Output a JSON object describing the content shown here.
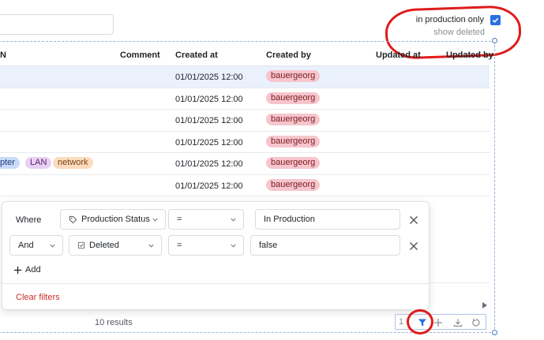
{
  "toggles": {
    "production_label": "in production only",
    "deleted_label": "show deleted"
  },
  "columns": [
    "N",
    "Comment",
    "Created at",
    "Created by",
    "Updated at",
    "Updated by"
  ],
  "rows": [
    {
      "created_at": "01/01/2025 12:00",
      "created_by": "bauergeorg",
      "selected": true
    },
    {
      "created_at": "01/01/2025 12:00",
      "created_by": "bauergeorg"
    },
    {
      "created_at": "01/01/2025 12:00",
      "created_by": "bauergeorg"
    },
    {
      "created_at": "01/01/2025 12:00",
      "created_by": "bauergeorg"
    },
    {
      "created_at": "01/01/2025 12:00",
      "created_by": "bauergeorg",
      "tags": [
        "pter",
        "LAN",
        "network"
      ]
    },
    {
      "created_at": "01/01/2025 12:00",
      "created_by": "bauergeorg"
    }
  ],
  "tag_colors": {
    "pter": "#c9daf8",
    "LAN": "#e8d0f2",
    "network": "#fbdcbf",
    "user": "#f6c6cc"
  },
  "filter": {
    "rows": [
      {
        "conjunction": "Where",
        "field": "Production Status",
        "field_icon": "tag-icon",
        "operator": "=",
        "value": "In Production"
      },
      {
        "conjunction": "And",
        "field": "Deleted",
        "field_icon": "checkbox-icon",
        "operator": "=",
        "value": "false"
      }
    ],
    "add_label": "Add",
    "clear_label": "Clear filters"
  },
  "footer": {
    "results": "10 results",
    "page": "1"
  },
  "colors": {
    "accent": "#2b6fe0",
    "annotation": "#e01b1b",
    "danger": "#c9302c"
  }
}
